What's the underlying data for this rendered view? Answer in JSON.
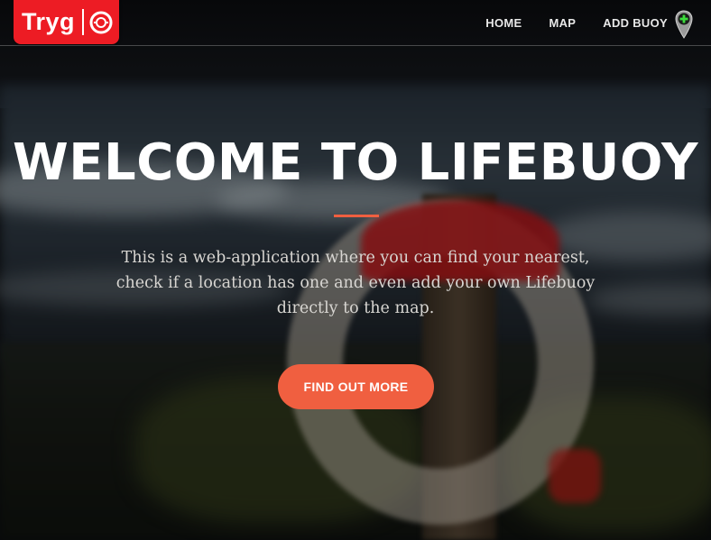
{
  "brand": {
    "name": "Tryg",
    "icon": "lifebuoy-ring-icon",
    "color": "#ed1c24"
  },
  "nav": {
    "links": [
      {
        "label": "HOME"
      },
      {
        "label": "MAP"
      },
      {
        "label": "ADD BUOY",
        "icon": "map-pin-plus-icon"
      }
    ]
  },
  "hero": {
    "title": "WELCOME TO LIFEBUOY",
    "text": "This is a web-application where you can find your nearest, check if a location has one and even add your own Lifebuoy directly to the map.",
    "button_label": "FIND OUT MORE",
    "accent_color": "#f05f40"
  }
}
